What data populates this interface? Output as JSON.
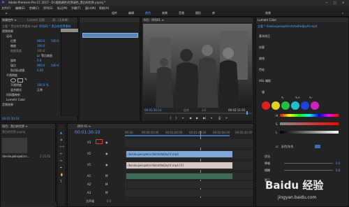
{
  "window": {
    "title": "Adobe Premiere Pro CC 2017 - D:\\视频调色\\世界调色_黑白的世界.prproj *",
    "menu": [
      "文件(F)",
      "编辑(E)",
      "剪辑(C)",
      "序列(S)",
      "标记(M)",
      "字幕(T)",
      "窗口(W)",
      "帮助(H)"
    ],
    "workspace_tabs": [
      "组件",
      "编辑",
      "颜色",
      "效果",
      "音频",
      "图形",
      "库"
    ],
    "top_right": "效果"
  },
  "effect_controls": {
    "tab_left": "效果控件 ≡",
    "tab_mid": "Lumetri 范围",
    "tab_right": "源：(无剪辑)",
    "source_label": "主要 * 黑白的世界素材.mp4",
    "sequence_label": "序列01 * 黑白的世界素材",
    "section_video": "视频效果",
    "rows": [
      {
        "label": "运动",
        "value": ""
      },
      {
        "label": "位置",
        "value": "960.0",
        "value2": "540.0"
      },
      {
        "label": "缩放",
        "value": "100.0"
      },
      {
        "label": "缩放宽度",
        "value": "100.0"
      },
      {
        "label": "等比缩放",
        "value": "☑"
      },
      {
        "label": "旋转",
        "value": "0.0"
      },
      {
        "label": "锚点",
        "value": "960.0",
        "value2": "540.0"
      },
      {
        "label": "防闪烁滤镜",
        "value": "0.00"
      },
      {
        "label": "不透明度",
        "value": ""
      },
      {
        "label": "不透明度",
        "value": "100.0 %"
      },
      {
        "label": "混合模式",
        "value": "正常"
      },
      {
        "label": "时间重映射",
        "value": ""
      },
      {
        "label": "Lumetri Color",
        "value": ""
      },
      {
        "label": "音频效果",
        "value": ""
      }
    ],
    "timecode": "00:01:30:10"
  },
  "program": {
    "tab": "节目：序列01 ≡",
    "timecode_left": "00:01:30:10",
    "timecode_right": "00:02:11:01",
    "fit": "适合",
    "ratio": "1/2"
  },
  "project": {
    "tab": "项目：黑白的世界 ≡",
    "file_tab": "黑白的世界.prproj",
    "item_name": "rbesloujwlsqwtsrs...",
    "item_duration": "2:11:01"
  },
  "timeline": {
    "tab": "序列 01 ≡",
    "timecode": "00:01:30:10",
    "ruler": [
      "00:00",
      "00:00:30:00",
      "00:01:00:00",
      "00:01:30:00",
      "00:02:00:00",
      "00:02:30:00"
    ],
    "tracks_video": [
      "V3",
      "V2",
      "V1"
    ],
    "tracks_audio": [
      "A1",
      "A2",
      "A3"
    ],
    "clip_v2": "rbesloujwlsqwtsrsfwtxbfwljbyht.mp4",
    "clip_v1": "rbesloujwlsqwtsrsfwtxbfwljbyht.mp4 [V]",
    "master": "主声道",
    "master_value": "0.0"
  },
  "lumetri": {
    "title": "Lumetri Color",
    "clip_label": "主要 * rbesloujwlsqwtsrsfwtxbfwljbyht.mp4",
    "sections": [
      "基本校正",
      "创意",
      "曲线",
      "色轮",
      "HSL 辅助"
    ],
    "hsl_key": "键",
    "hsl_labels": [
      "H",
      "S",
      "L"
    ],
    "show_mask": "彩色/灰色",
    "refine": "优化",
    "denoise": "降噪",
    "blur": "模糊",
    "correction": "更正",
    "denoise_value": "0.0",
    "blur_value": "0.0"
  },
  "watermark": {
    "site": "jingyan.baidu.com",
    "brand": "Baidu 经验"
  }
}
